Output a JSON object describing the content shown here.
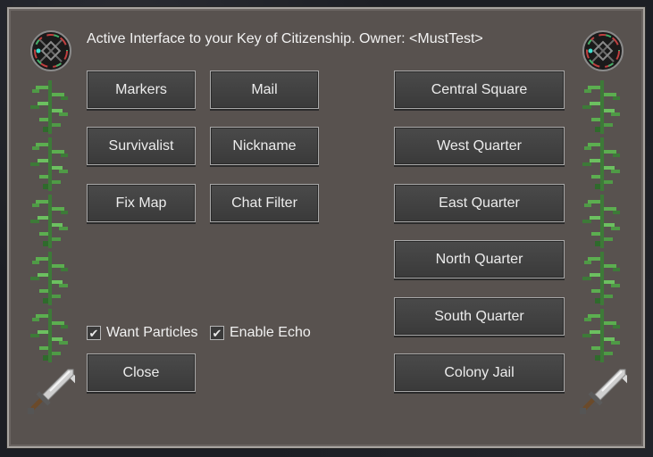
{
  "header": {
    "title": "Active Interface to your Key of Citizenship. Owner: <MustTest>"
  },
  "left_buttons": [
    {
      "label": "Markers"
    },
    {
      "label": "Mail"
    },
    {
      "label": "Survivalist"
    },
    {
      "label": "Nickname"
    },
    {
      "label": "Fix Map"
    },
    {
      "label": "Chat Filter"
    }
  ],
  "destinations": [
    {
      "label": "Central Square"
    },
    {
      "label": "West Quarter"
    },
    {
      "label": "East Quarter"
    },
    {
      "label": "North Quarter"
    },
    {
      "label": "South Quarter"
    },
    {
      "label": "Colony Jail"
    }
  ],
  "options": {
    "want_particles": {
      "label": "Want Particles",
      "checked": true
    },
    "enable_echo": {
      "label": "Enable Echo",
      "checked": true
    }
  },
  "close_button": {
    "label": "Close"
  },
  "icons": {
    "emblem": "key-emblem-icon",
    "vine": "vine-icon",
    "sword": "sword-icon"
  },
  "colors": {
    "panel": "#58524f",
    "button": "#444444",
    "vine": "#4f9a46"
  }
}
